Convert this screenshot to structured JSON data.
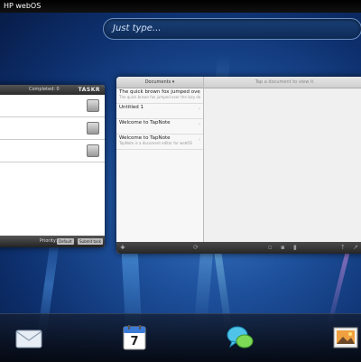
{
  "status_bar": {
    "title": "HP webOS"
  },
  "search": {
    "placeholder": "Just type..."
  },
  "taskr": {
    "completed_label": "Completed: 0",
    "brand": "TASKR",
    "rows": 3,
    "footer_label": "Priority:",
    "footer_buttons": [
      "Default",
      "Submit task"
    ]
  },
  "tapnote": {
    "left_header": "Documents ▾",
    "right_header": "Tap a document to view it",
    "documents": [
      {
        "title": "The quick brown fox jumped over the",
        "subtitle": "The quick brown fox jumped over the lazy dog"
      },
      {
        "title": "Untitled 1",
        "subtitle": ""
      },
      {
        "title": "Welcome to TapNote",
        "subtitle": ""
      },
      {
        "title": "Welcome to TapNote",
        "subtitle": "TapNote is a document editor for webOS"
      }
    ]
  },
  "dock": {
    "icons": [
      "email-icon",
      "calendar-icon",
      "messaging-icon",
      "photos-icon"
    ],
    "calendar_day": "7"
  },
  "colors": {
    "wallpaper": "#1d4f9a",
    "dock": "#0a1020"
  }
}
